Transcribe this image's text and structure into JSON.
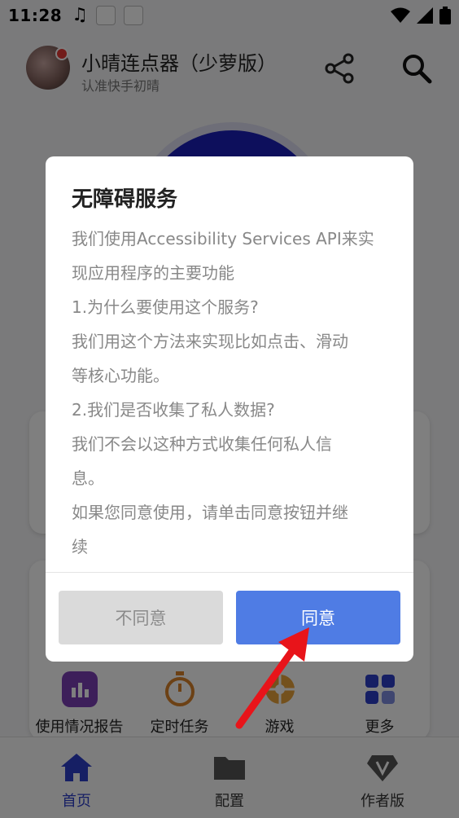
{
  "status_bar": {
    "time": "11:28"
  },
  "header": {
    "title": "小晴连点器（少萝版）",
    "subtitle": "认准快手初晴"
  },
  "tools": [
    {
      "label": "使用情况报告",
      "icon": "bar-chart-icon",
      "color": "#7b3fb5"
    },
    {
      "label": "定时任务",
      "icon": "stopwatch-icon",
      "color": "#d9822b"
    },
    {
      "label": "游戏",
      "icon": "wheel-icon",
      "color": "#e8a23a"
    },
    {
      "label": "更多",
      "icon": "grid-icon",
      "color": "#2c3ec9"
    }
  ],
  "bottom_nav": [
    {
      "label": "首页",
      "icon": "home-icon",
      "active": true
    },
    {
      "label": "配置",
      "icon": "folder-icon",
      "active": false
    },
    {
      "label": "作者版",
      "icon": "diamond-v-icon",
      "active": false
    }
  ],
  "dialog": {
    "title": "无障碍服务",
    "lines": [
      "我们使用Accessibility Services API来实",
      "现应用程序的主要功能",
      "1.为什么要使用这个服务?",
      "我们用这个方法来实现比如点击、滑动",
      "等核心功能。",
      "2.我们是否收集了私人数据?",
      "我们不会以这种方式收集任何私人信",
      "息。",
      "如果您同意使用，请单击同意按钮并继",
      "续"
    ],
    "disagree_label": "不同意",
    "agree_label": "同意"
  },
  "colors": {
    "accent": "#4f7ce4",
    "annotation_arrow": "#e8141a",
    "nav_active": "#2c3ec9"
  }
}
